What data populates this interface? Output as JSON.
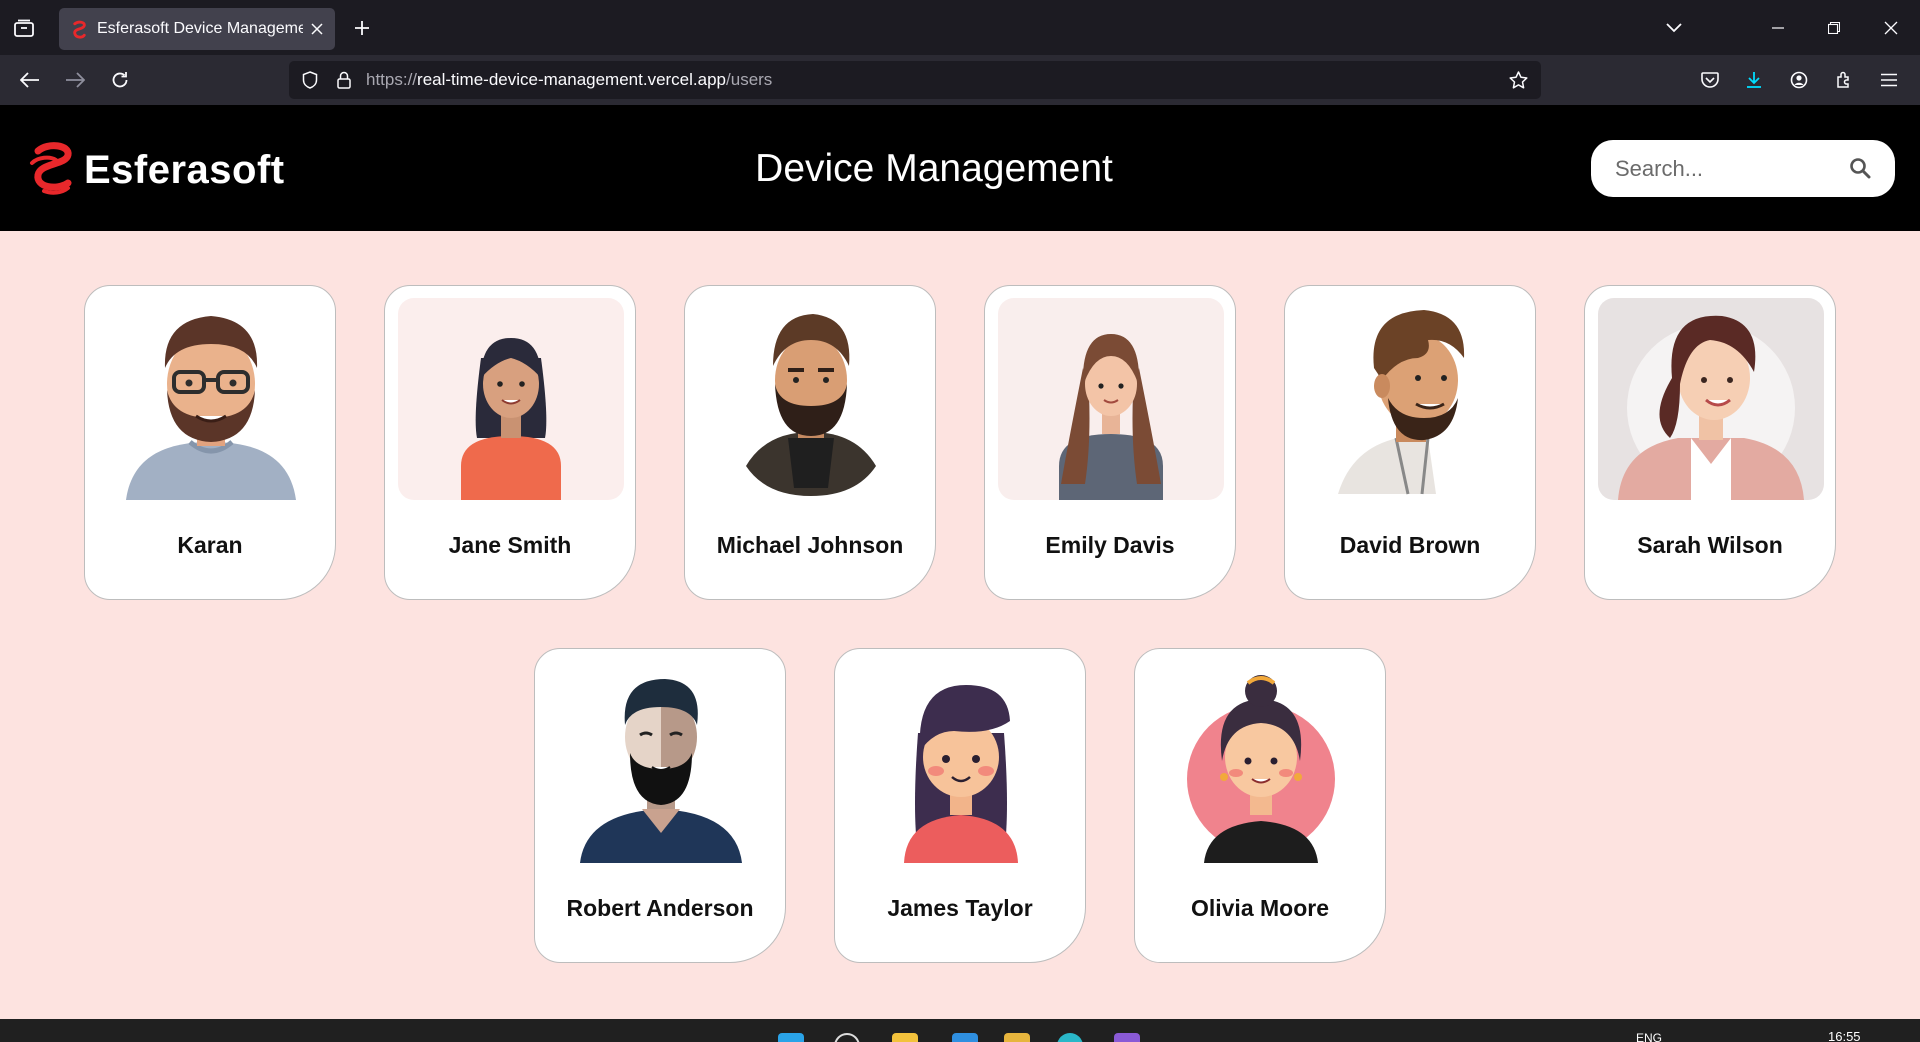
{
  "browser": {
    "tab_title": "Esferasoft Device Management",
    "url_protocol": "https://",
    "url_host": "real-time-device-management.vercel.app",
    "url_path": "/users",
    "accent": "#00ddff"
  },
  "app": {
    "brand_name": "Esferasoft",
    "page_title": "Device Management",
    "search_placeholder": "Search...",
    "brand_color": "#e8282b"
  },
  "users": [
    {
      "name": "Karan"
    },
    {
      "name": "Jane Smith"
    },
    {
      "name": "Michael Johnson"
    },
    {
      "name": "Emily Davis"
    },
    {
      "name": "David Brown"
    },
    {
      "name": "Sarah Wilson"
    },
    {
      "name": "Robert Anderson"
    },
    {
      "name": "James Taylor"
    },
    {
      "name": "Olivia Moore"
    }
  ],
  "taskbar": {
    "language": "ENG",
    "time": "16:55"
  }
}
